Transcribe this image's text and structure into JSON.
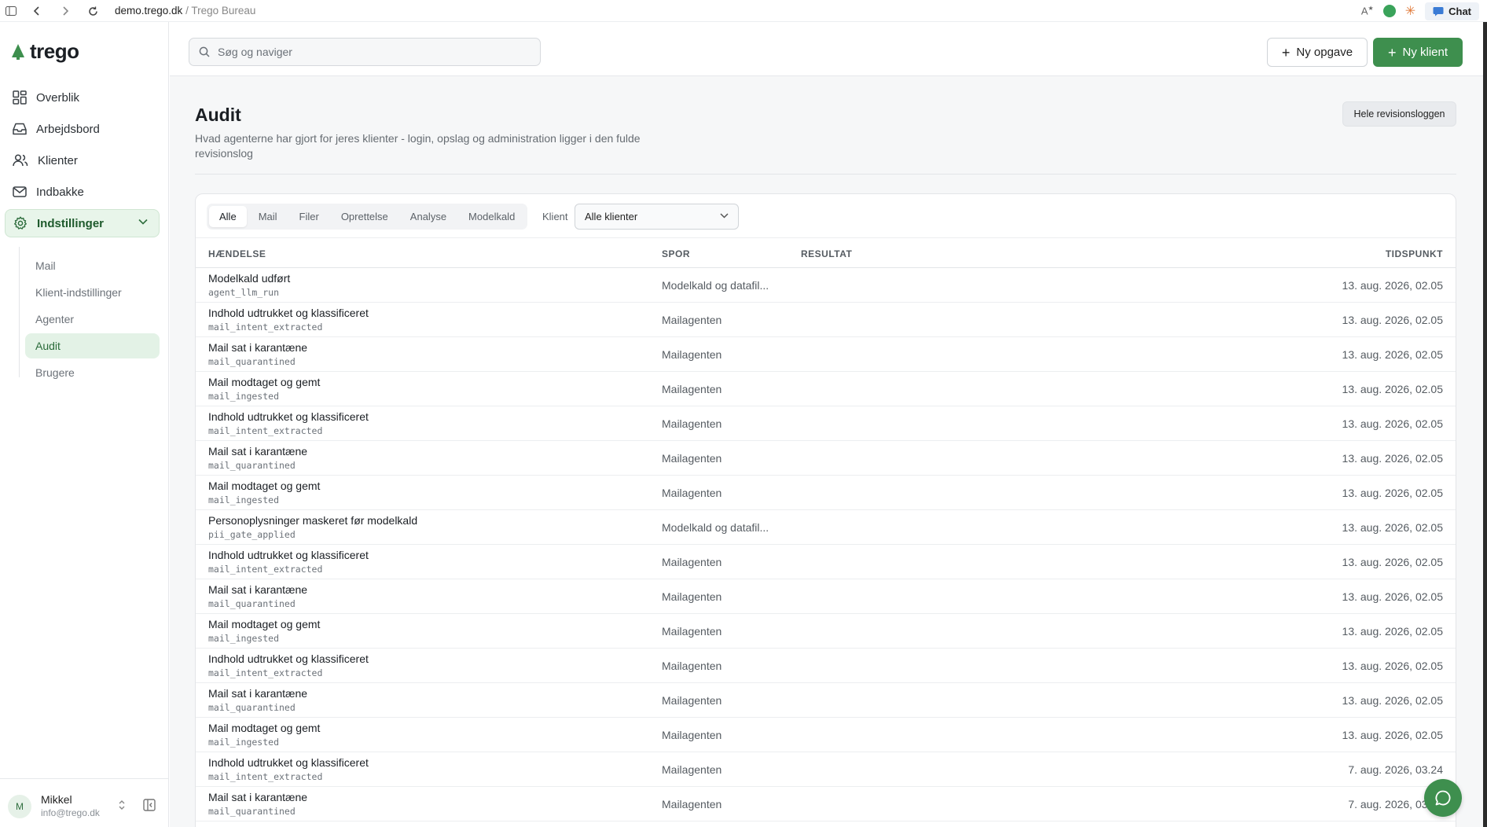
{
  "browser": {
    "url_host": "demo.trego.dk",
    "url_separator": "/",
    "page_title": "Trego Bureau",
    "chat_label": "Chat"
  },
  "sidebar": {
    "logo_text": "trego",
    "nav": [
      {
        "label": "Overblik",
        "icon": "grid-icon"
      },
      {
        "label": "Arbejdsbord",
        "icon": "inbox-tray-icon"
      },
      {
        "label": "Klienter",
        "icon": "users-icon"
      },
      {
        "label": "Indbakke",
        "icon": "mail-icon"
      },
      {
        "label": "Indstillinger",
        "icon": "gear-icon"
      }
    ],
    "settings_sub": [
      "Mail",
      "Klient-indstillinger",
      "Agenter",
      "Audit",
      "Brugere"
    ],
    "active_sub": "Audit",
    "user": {
      "initial": "M",
      "name": "Mikkel",
      "email": "info@trego.dk"
    }
  },
  "topbar": {
    "search_placeholder": "Søg og naviger",
    "new_task_label": "Ny opgave",
    "new_client_label": "Ny klient"
  },
  "page": {
    "title": "Audit",
    "description": "Hvad agenterne har gjort for jeres klienter - login, opslag og administration ligger i den fulde revisionslog",
    "full_log_button": "Hele revisionsloggen"
  },
  "filters": {
    "tabs": [
      "Alle",
      "Mail",
      "Filer",
      "Oprettelse",
      "Analyse",
      "Modelkald"
    ],
    "active_tab": "Alle",
    "client_label": "Klient",
    "client_value": "Alle klienter"
  },
  "table": {
    "headers": {
      "event": "HÆNDELSE",
      "trace": "SPOR",
      "result": "RESULTAT",
      "time": "TIDSPUNKT"
    },
    "rows": [
      {
        "title": "Modelkald udført",
        "code": "agent_llm_run",
        "spor": "Modelkald og datafil...",
        "result": "",
        "time": "13. aug. 2026, 02.05"
      },
      {
        "title": "Indhold udtrukket og klassificeret",
        "code": "mail_intent_extracted",
        "spor": "Mailagenten",
        "result": "",
        "time": "13. aug. 2026, 02.05"
      },
      {
        "title": "Mail sat i karantæne",
        "code": "mail_quarantined",
        "spor": "Mailagenten",
        "result": "",
        "time": "13. aug. 2026, 02.05"
      },
      {
        "title": "Mail modtaget og gemt",
        "code": "mail_ingested",
        "spor": "Mailagenten",
        "result": "",
        "time": "13. aug. 2026, 02.05"
      },
      {
        "title": "Indhold udtrukket og klassificeret",
        "code": "mail_intent_extracted",
        "spor": "Mailagenten",
        "result": "",
        "time": "13. aug. 2026, 02.05"
      },
      {
        "title": "Mail sat i karantæne",
        "code": "mail_quarantined",
        "spor": "Mailagenten",
        "result": "",
        "time": "13. aug. 2026, 02.05"
      },
      {
        "title": "Mail modtaget og gemt",
        "code": "mail_ingested",
        "spor": "Mailagenten",
        "result": "",
        "time": "13. aug. 2026, 02.05"
      },
      {
        "title": "Personoplysninger maskeret før modelkald",
        "code": "pii_gate_applied",
        "spor": "Modelkald og datafil...",
        "result": "",
        "time": "13. aug. 2026, 02.05"
      },
      {
        "title": "Indhold udtrukket og klassificeret",
        "code": "mail_intent_extracted",
        "spor": "Mailagenten",
        "result": "",
        "time": "13. aug. 2026, 02.05"
      },
      {
        "title": "Mail sat i karantæne",
        "code": "mail_quarantined",
        "spor": "Mailagenten",
        "result": "",
        "time": "13. aug. 2026, 02.05"
      },
      {
        "title": "Mail modtaget og gemt",
        "code": "mail_ingested",
        "spor": "Mailagenten",
        "result": "",
        "time": "13. aug. 2026, 02.05"
      },
      {
        "title": "Indhold udtrukket og klassificeret",
        "code": "mail_intent_extracted",
        "spor": "Mailagenten",
        "result": "",
        "time": "13. aug. 2026, 02.05"
      },
      {
        "title": "Mail sat i karantæne",
        "code": "mail_quarantined",
        "spor": "Mailagenten",
        "result": "",
        "time": "13. aug. 2026, 02.05"
      },
      {
        "title": "Mail modtaget og gemt",
        "code": "mail_ingested",
        "spor": "Mailagenten",
        "result": "",
        "time": "13. aug. 2026, 02.05"
      },
      {
        "title": "Indhold udtrukket og klassificeret",
        "code": "mail_intent_extracted",
        "spor": "Mailagenten",
        "result": "",
        "time": "7. aug. 2026, 03.24"
      },
      {
        "title": "Mail sat i karantæne",
        "code": "mail_quarantined",
        "spor": "Mailagenten",
        "result": "",
        "time": "7. aug. 2026, 03.24"
      }
    ]
  },
  "colors": {
    "brand_green": "#3e8f4e",
    "active_bg": "#e3f2e6"
  }
}
